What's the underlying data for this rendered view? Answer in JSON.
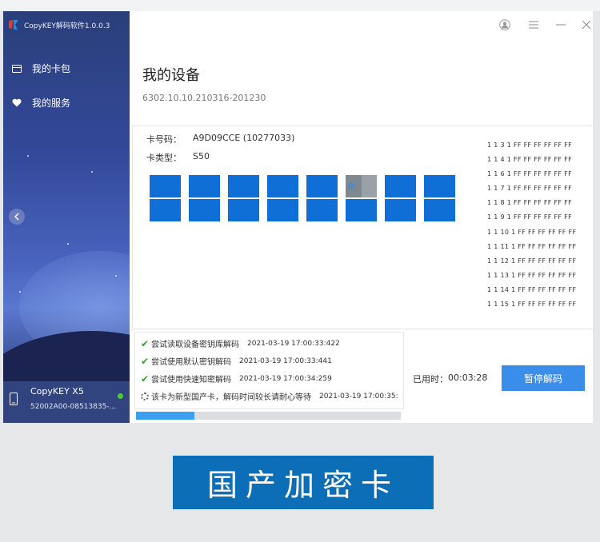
{
  "app": {
    "title": "CopyKEY解码软件1.0.0.3"
  },
  "sidebar": {
    "items": [
      {
        "label": "我的卡包",
        "icon": "card-icon"
      },
      {
        "label": "我的服务",
        "icon": "heart-icon"
      }
    ],
    "device": {
      "name": "CopyKEY X5",
      "id": "52002A00-08513835-...",
      "status": "online"
    }
  },
  "window_controls": [
    "user-icon",
    "menu-icon",
    "minimize-icon",
    "close-icon"
  ],
  "main": {
    "title": "我的设备",
    "subtitle": "6302.10.10.210316-201230",
    "card": {
      "number_label": "卡号码：",
      "number_value": "A9D09CCE (10277033)",
      "type_label": "卡类型：",
      "type_value": "S50"
    },
    "sectors": {
      "count": 16,
      "in_progress_index": 5
    },
    "hex_rows": [
      "1 1 3 1 FF FF FF FF FF FF",
      "1 1 4 1 FF FF FF FF FF FF",
      "1 1 6 1 FF FF FF FF FF FF",
      "1 1 7 1 FF FF FF FF FF FF",
      "1 1 8 1 FF FF FF FF FF FF",
      "1 1 9 1 FF FF FF FF FF FF",
      "1 1 10 1 FF FF FF FF FF FF",
      "1 1 11 1 FF FF FF FF FF FF",
      "1 1 12 1 FF FF FF FF FF FF",
      "1 1 13 1 FF FF FF FF FF FF",
      "1 1 14 1 FF FF FF FF FF FF",
      "1 1 15 1 FF FF FF FF FF FF"
    ]
  },
  "log": [
    {
      "status": "done",
      "message": "尝试读取设备密钥库解码",
      "time": "2021-03-19 17:00:33:422"
    },
    {
      "status": "done",
      "message": "尝试使用默认密钥解码",
      "time": "2021-03-19 17:00:33:441"
    },
    {
      "status": "done",
      "message": "尝试使用快速知密解码",
      "time": "2021-03-19 17:00:34:259"
    },
    {
      "status": "running",
      "message": "该卡为新型国产卡，解码时间较长请耐心等待",
      "time": "2021-03-19 17:00:35:"
    }
  ],
  "progress": 0.22,
  "elapsed": {
    "label": "已用时：",
    "value": "00:03:28"
  },
  "pause_button": "暂停解码",
  "banner": "国产加密卡",
  "colors": {
    "accent": "#3a8de8",
    "sector_blue": "#0f6fd6",
    "banner": "#0d6eb8",
    "success": "#2ea12e"
  }
}
